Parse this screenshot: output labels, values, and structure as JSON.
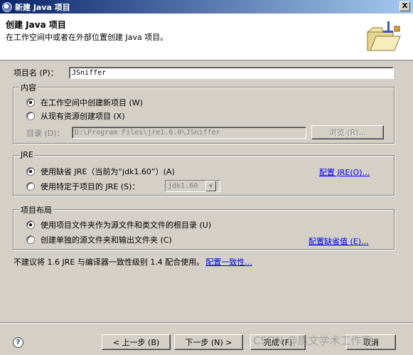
{
  "window": {
    "title": "新建 Java 项目",
    "close_label": "X"
  },
  "header": {
    "title": "创建 Java 项目",
    "description": "在工作空间中或者在外部位置创建 Java 项目。",
    "icon": "folder-wizard-icon"
  },
  "project_name": {
    "label": "项目名 (P)：",
    "value": "JSniffer"
  },
  "contents": {
    "title": "内容",
    "options": [
      {
        "label": "在工作空间中创建新项目 (W)",
        "checked": true
      },
      {
        "label": "从现有资源创建项目 (X)",
        "checked": false
      }
    ],
    "directory_label": "目录 (D)：",
    "directory_value": "D:\\Program Files\\jre1.6.0\\JSniffer",
    "browse_label": "浏览 (R)..."
  },
  "jre": {
    "title": "JRE",
    "options": [
      {
        "label": "使用缺省 JRE（当前为“jdk1.60”）(A)",
        "checked": true
      },
      {
        "label": "使用特定于项目的 JRE (S)：",
        "checked": false
      }
    ],
    "configure_link": "配置 JRE(O)...",
    "specific_value": "jdk1.60"
  },
  "layout": {
    "title": "项目布局",
    "options": [
      {
        "label": "使用项目文件夹作为源文件和类文件的根目录 (U)",
        "checked": true
      },
      {
        "label": "创建单独的源文件夹和输出文件夹 (C)",
        "checked": false
      }
    ],
    "configure_link": "配置缺省值 (E)..."
  },
  "warning": {
    "text": "不建议将 1.6 JRE 与编译器一致性级别 1.4 配合使用。",
    "link": "配置一致性..."
  },
  "footer": {
    "help_label": "?",
    "back_label": "< 上一步 (B)",
    "next_label": "下一步 (N) >",
    "finish_label": "完成 (F)",
    "cancel_label": "取消",
    "watermark": "CSDN @质文学术工作室"
  },
  "colors": {
    "dialog_bg": "#d4d0c8",
    "titlebar_start": "#0a246a",
    "titlebar_end": "#a6caf0",
    "link": "#0000ee"
  }
}
